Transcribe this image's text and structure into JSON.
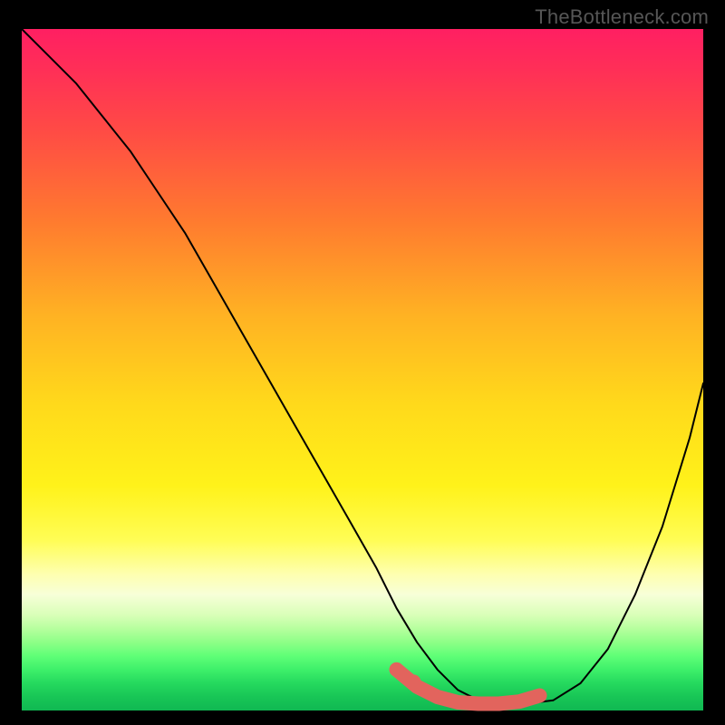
{
  "watermark": {
    "text": "TheBottleneck.com"
  },
  "chart_data": {
    "type": "line",
    "title": "",
    "xlabel": "",
    "ylabel": "",
    "xlim": [
      0,
      100
    ],
    "ylim": [
      0,
      100
    ],
    "grid": false,
    "legend": false,
    "series": [
      {
        "name": "bottleneck-curve",
        "x": [
          0,
          4,
          8,
          12,
          16,
          20,
          24,
          28,
          32,
          36,
          40,
          44,
          48,
          52,
          55,
          58,
          61,
          64,
          67,
          70,
          74,
          78,
          82,
          86,
          90,
          94,
          98,
          100
        ],
        "y": [
          100,
          96,
          92,
          87,
          82,
          76,
          70,
          63,
          56,
          49,
          42,
          35,
          28,
          21,
          15,
          10,
          6,
          3,
          1.5,
          1,
          1,
          1.5,
          4,
          9,
          17,
          27,
          40,
          48
        ]
      }
    ],
    "optimal_marker": {
      "name": "optimal-range",
      "x": [
        55,
        58,
        61,
        64,
        67,
        70,
        73,
        76
      ],
      "y": [
        6,
        3.5,
        2,
        1.2,
        1,
        1,
        1.3,
        2.2
      ],
      "dots_x": [
        55,
        57.5
      ],
      "dots_y": [
        6,
        4.2
      ]
    },
    "background_gradient": {
      "top": "#ff1f62",
      "mid": "#fff21a",
      "bottom": "#10b852",
      "meaning": "red=high bottleneck, green=optimal"
    }
  }
}
